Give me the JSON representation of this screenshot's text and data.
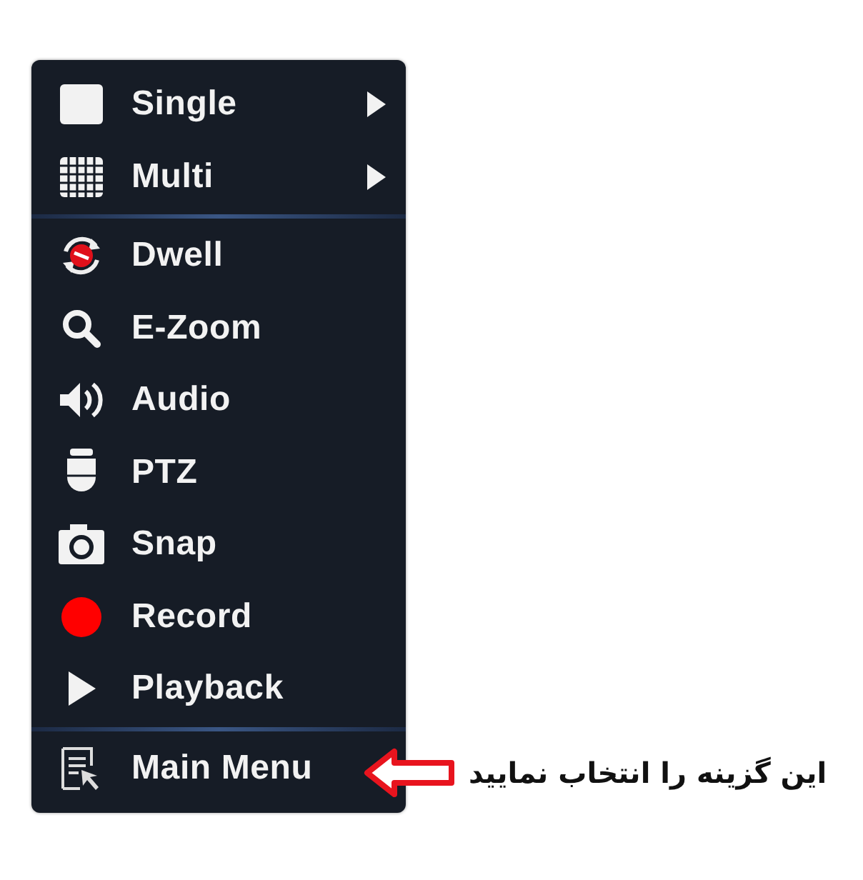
{
  "menu": {
    "groups": [
      [
        {
          "label": "Single",
          "kind": "single",
          "submenu": true
        },
        {
          "label": "Multi",
          "kind": "multi",
          "submenu": true
        }
      ],
      [
        {
          "label": "Dwell",
          "kind": "dwell",
          "submenu": false
        },
        {
          "label": "E-Zoom",
          "kind": "zoom",
          "submenu": false
        },
        {
          "label": "Audio",
          "kind": "audio",
          "submenu": false
        },
        {
          "label": "PTZ",
          "kind": "ptz",
          "submenu": false
        },
        {
          "label": "Snap",
          "kind": "snap",
          "submenu": false
        },
        {
          "label": "Record",
          "kind": "record",
          "submenu": false
        },
        {
          "label": "Playback",
          "kind": "playback",
          "submenu": false
        }
      ],
      [
        {
          "label": "Main Menu",
          "kind": "mainmenu",
          "submenu": false
        }
      ]
    ]
  },
  "annotation": {
    "text": "این گزینه را انتخاب نمایید"
  }
}
